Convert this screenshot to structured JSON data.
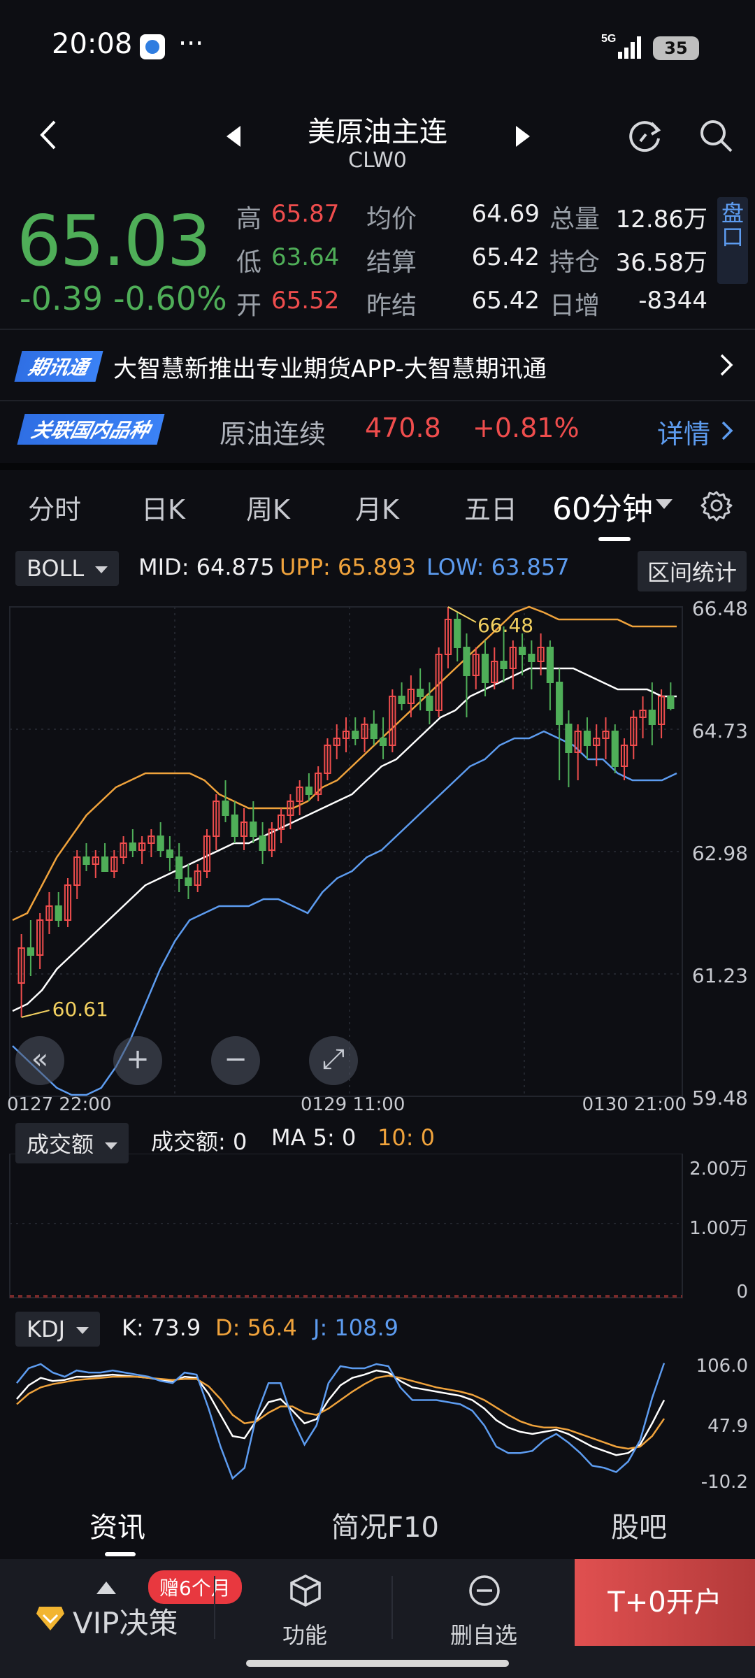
{
  "status_bar": {
    "time": "20:08",
    "more": "···",
    "network": "5G",
    "battery": "35",
    "signal_icon": "signal-icon"
  },
  "header": {
    "title": "美原油主连",
    "code": "CLW0"
  },
  "quote": {
    "price": "65.03",
    "change": "-0.39",
    "change_pct": "-0.60%",
    "high_label": "高",
    "high": "65.87",
    "low_label": "低",
    "low": "63.64",
    "open_label": "开",
    "open": "65.52",
    "avg_label": "均价",
    "avg": "64.69",
    "settle_label": "结算",
    "settle": "65.42",
    "prev_settle_label": "昨结",
    "prev_settle": "65.42",
    "volume_label": "总量",
    "volume": "12.86万",
    "oi_label": "持仓",
    "oi": "36.58万",
    "daily_inc_label": "日增",
    "daily_inc": "-8344",
    "pankou": "盘口"
  },
  "banner1": {
    "tag": "期讯通",
    "text": "大智慧新推出专业期货APP-大智慧期讯通"
  },
  "banner2": {
    "tag": "关联国内品种",
    "name": "原油连续",
    "price": "470.8",
    "pct": "+0.81%",
    "detail": "详情"
  },
  "tabs": [
    "分时",
    "日K",
    "周K",
    "月K",
    "五日",
    "60分钟"
  ],
  "boll": {
    "button": "BOLL",
    "mid": "MID: 64.875",
    "upp": "UPP: 65.893",
    "low": "LOW: 63.857",
    "range_stats": "区间统计"
  },
  "volume_panel": {
    "button": "成交额",
    "value": "成交额: 0",
    "ma5": "MA 5: 0",
    "ma10": "10: 0"
  },
  "kdj": {
    "button": "KDJ",
    "k": "K: 73.9",
    "d": "D: 56.4",
    "j": "J: 108.9"
  },
  "bottom_tabs": [
    "资讯",
    "简况F10",
    "股吧"
  ],
  "actions": {
    "gift": "赠6个月",
    "vip": "VIP决策",
    "func": "功能",
    "unfav": "删自选",
    "open": "T+0开户"
  },
  "colors": {
    "up": "#ef4d4d",
    "down": "#4fae58",
    "upp_line": "#f0a33c",
    "low_line": "#5d9cf0",
    "mid_line": "#ffffff"
  },
  "chart_data": [
    {
      "type": "candlestick",
      "title": "",
      "y_ticks": [
        "66.48",
        "64.73",
        "62.98",
        "61.23",
        "59.48"
      ],
      "ylim": [
        59.48,
        66.48
      ],
      "x_ticks": [
        "0127  22:00",
        "0129  11:00",
        "0130  21:00"
      ],
      "annotations": {
        "max": "66.48",
        "min": "60.61"
      },
      "candles": [
        [
          61.1,
          61.8,
          60.61,
          61.6
        ],
        [
          61.6,
          62.0,
          61.2,
          61.5
        ],
        [
          61.5,
          62.1,
          61.3,
          62.0
        ],
        [
          62.0,
          62.4,
          61.8,
          62.2
        ],
        [
          62.2,
          62.4,
          61.9,
          62.0
        ],
        [
          62.0,
          62.6,
          61.9,
          62.5
        ],
        [
          62.5,
          63.0,
          62.3,
          62.9
        ],
        [
          62.9,
          63.1,
          62.7,
          62.8
        ],
        [
          62.8,
          63.0,
          62.6,
          62.9
        ],
        [
          62.9,
          63.1,
          62.7,
          62.7
        ],
        [
          62.7,
          63.0,
          62.6,
          62.9
        ],
        [
          62.9,
          63.2,
          62.8,
          63.1
        ],
        [
          63.1,
          63.3,
          62.9,
          63.0
        ],
        [
          63.0,
          63.2,
          62.8,
          63.1
        ],
        [
          63.1,
          63.3,
          62.9,
          63.2
        ],
        [
          63.2,
          63.4,
          62.9,
          63.0
        ],
        [
          63.0,
          63.2,
          62.7,
          62.9
        ],
        [
          62.9,
          63.1,
          62.4,
          62.6
        ],
        [
          62.6,
          62.8,
          62.3,
          62.5
        ],
        [
          62.5,
          62.8,
          62.4,
          62.7
        ],
        [
          62.7,
          63.3,
          62.6,
          63.2
        ],
        [
          63.2,
          63.8,
          63.0,
          63.7
        ],
        [
          63.7,
          64.0,
          63.4,
          63.5
        ],
        [
          63.5,
          63.7,
          63.1,
          63.2
        ],
        [
          63.2,
          63.6,
          63.0,
          63.4
        ],
        [
          63.4,
          63.7,
          63.1,
          63.2
        ],
        [
          63.2,
          63.4,
          62.8,
          63.0
        ],
        [
          63.0,
          63.4,
          62.9,
          63.3
        ],
        [
          63.3,
          63.6,
          63.1,
          63.5
        ],
        [
          63.5,
          63.8,
          63.3,
          63.7
        ],
        [
          63.7,
          64.0,
          63.5,
          63.9
        ],
        [
          63.9,
          64.1,
          63.7,
          63.8
        ],
        [
          63.8,
          64.2,
          63.7,
          64.1
        ],
        [
          64.1,
          64.6,
          64.0,
          64.5
        ],
        [
          64.5,
          64.8,
          64.3,
          64.6
        ],
        [
          64.6,
          64.9,
          64.4,
          64.7
        ],
        [
          64.7,
          64.9,
          64.5,
          64.6
        ],
        [
          64.6,
          64.9,
          64.4,
          64.8
        ],
        [
          64.8,
          65.0,
          64.5,
          64.6
        ],
        [
          64.6,
          64.9,
          64.3,
          64.5
        ],
        [
          64.5,
          65.3,
          64.4,
          65.2
        ],
        [
          65.2,
          65.4,
          65.0,
          65.1
        ],
        [
          65.1,
          65.5,
          64.9,
          65.3
        ],
        [
          65.3,
          65.6,
          65.0,
          65.2
        ],
        [
          65.2,
          65.4,
          64.8,
          65.0
        ],
        [
          65.0,
          65.9,
          64.9,
          65.8
        ],
        [
          65.8,
          66.48,
          65.6,
          66.3
        ],
        [
          66.3,
          66.4,
          65.7,
          65.9
        ],
        [
          65.9,
          66.1,
          64.9,
          65.5
        ],
        [
          65.5,
          65.9,
          65.3,
          65.8
        ],
        [
          65.8,
          66.0,
          65.2,
          65.4
        ],
        [
          65.4,
          65.9,
          65.3,
          65.7
        ],
        [
          65.7,
          66.2,
          65.4,
          65.6
        ],
        [
          65.6,
          66.0,
          65.3,
          65.9
        ],
        [
          65.9,
          66.1,
          65.5,
          65.8
        ],
        [
          65.8,
          66.0,
          65.3,
          65.7
        ],
        [
          65.7,
          66.1,
          65.5,
          65.9
        ],
        [
          65.9,
          66.0,
          65.0,
          65.4
        ],
        [
          65.4,
          65.6,
          64.0,
          64.8
        ],
        [
          64.8,
          65.0,
          63.9,
          64.4
        ],
        [
          64.4,
          64.8,
          64.0,
          64.7
        ],
        [
          64.7,
          64.9,
          64.3,
          64.5
        ],
        [
          64.5,
          64.8,
          64.2,
          64.6
        ],
        [
          64.6,
          64.9,
          64.3,
          64.7
        ],
        [
          64.7,
          64.8,
          64.1,
          64.2
        ],
        [
          64.2,
          64.6,
          64.0,
          64.5
        ],
        [
          64.5,
          65.0,
          64.3,
          64.9
        ],
        [
          64.9,
          65.2,
          64.6,
          65.0
        ],
        [
          65.0,
          65.4,
          64.5,
          64.8
        ],
        [
          64.8,
          65.3,
          64.6,
          65.2
        ],
        [
          65.2,
          65.4,
          65.0,
          65.03
        ]
      ],
      "upp": [
        62.0,
        62.1,
        62.5,
        62.9,
        63.2,
        63.5,
        63.7,
        63.9,
        64.0,
        64.1,
        64.1,
        64.1,
        64.1,
        64.0,
        63.8,
        63.7,
        63.6,
        63.6,
        63.6,
        63.6,
        63.7,
        63.9,
        64.0,
        64.2,
        64.4,
        64.6,
        64.8,
        65.0,
        65.2,
        65.4,
        65.6,
        65.8,
        66.0,
        66.2,
        66.4,
        66.48,
        66.4,
        66.3,
        66.3,
        66.3,
        66.3,
        66.3,
        66.2,
        66.2,
        66.2,
        66.2
      ],
      "mid": [
        60.7,
        60.8,
        61.0,
        61.3,
        61.5,
        61.7,
        61.9,
        62.1,
        62.3,
        62.5,
        62.6,
        62.7,
        62.8,
        62.9,
        63.0,
        63.1,
        63.1,
        63.2,
        63.3,
        63.4,
        63.5,
        63.6,
        63.7,
        63.8,
        64.0,
        64.2,
        64.3,
        64.5,
        64.7,
        64.9,
        65.0,
        65.2,
        65.3,
        65.4,
        65.5,
        65.6,
        65.6,
        65.6,
        65.6,
        65.5,
        65.4,
        65.3,
        65.3,
        65.3,
        65.2,
        65.2
      ],
      "low": [
        60.2,
        60.0,
        59.8,
        59.6,
        59.5,
        59.5,
        59.6,
        59.9,
        60.3,
        60.8,
        61.3,
        61.7,
        62.0,
        62.1,
        62.2,
        62.2,
        62.2,
        62.3,
        62.3,
        62.2,
        62.1,
        62.4,
        62.6,
        62.7,
        62.9,
        63.0,
        63.2,
        63.4,
        63.6,
        63.8,
        64.0,
        64.2,
        64.3,
        64.5,
        64.6,
        64.6,
        64.7,
        64.6,
        64.5,
        64.3,
        64.3,
        64.1,
        64.0,
        64.0,
        64.0,
        64.1
      ]
    },
    {
      "type": "bar",
      "title": "成交额",
      "y_ticks": [
        "2.00万",
        "1.00万",
        "0"
      ],
      "ylim": [
        0,
        20000
      ],
      "values": [
        0
      ]
    },
    {
      "type": "line",
      "title": "KDJ",
      "y_ticks": [
        "106.0",
        "47.9",
        "-10.2"
      ],
      "ylim": [
        -10.2,
        106.0
      ],
      "series": [
        {
          "name": "K",
          "values": [
            75,
            88,
            95,
            92,
            93,
            96,
            96,
            97,
            98,
            97,
            96,
            95,
            93,
            92,
            96,
            95,
            80,
            60,
            40,
            38,
            55,
            72,
            75,
            64,
            52,
            56,
            74,
            88,
            95,
            98,
            102,
            100,
            92,
            86,
            84,
            82,
            80,
            78,
            74,
            66,
            55,
            48,
            44,
            42,
            44,
            46,
            42,
            36,
            30,
            26,
            22,
            24,
            32,
            52,
            73.9
          ]
        },
        {
          "name": "D",
          "values": [
            70,
            80,
            86,
            89,
            91,
            93,
            94,
            95,
            96,
            96,
            96,
            95,
            94,
            93,
            94,
            94,
            87,
            75,
            60,
            52,
            54,
            62,
            68,
            68,
            62,
            60,
            66,
            74,
            82,
            89,
            95,
            97,
            95,
            92,
            89,
            86,
            84,
            82,
            79,
            74,
            67,
            60,
            54,
            50,
            48,
            48,
            46,
            42,
            38,
            34,
            30,
            28,
            30,
            40,
            56.4
          ]
        },
        {
          "name": "J",
          "values": [
            90,
            104,
            108,
            100,
            96,
            102,
            100,
            100,
            102,
            100,
            98,
            96,
            92,
            90,
            100,
            98,
            66,
            30,
            0,
            10,
            60,
            90,
            90,
            56,
            32,
            50,
            90,
            106,
            104,
            104,
            108,
            106,
            86,
            74,
            74,
            74,
            72,
            70,
            64,
            50,
            30,
            24,
            24,
            26,
            36,
            42,
            34,
            24,
            12,
            10,
            6,
            16,
            36,
            76,
            108.9
          ]
        }
      ]
    }
  ]
}
